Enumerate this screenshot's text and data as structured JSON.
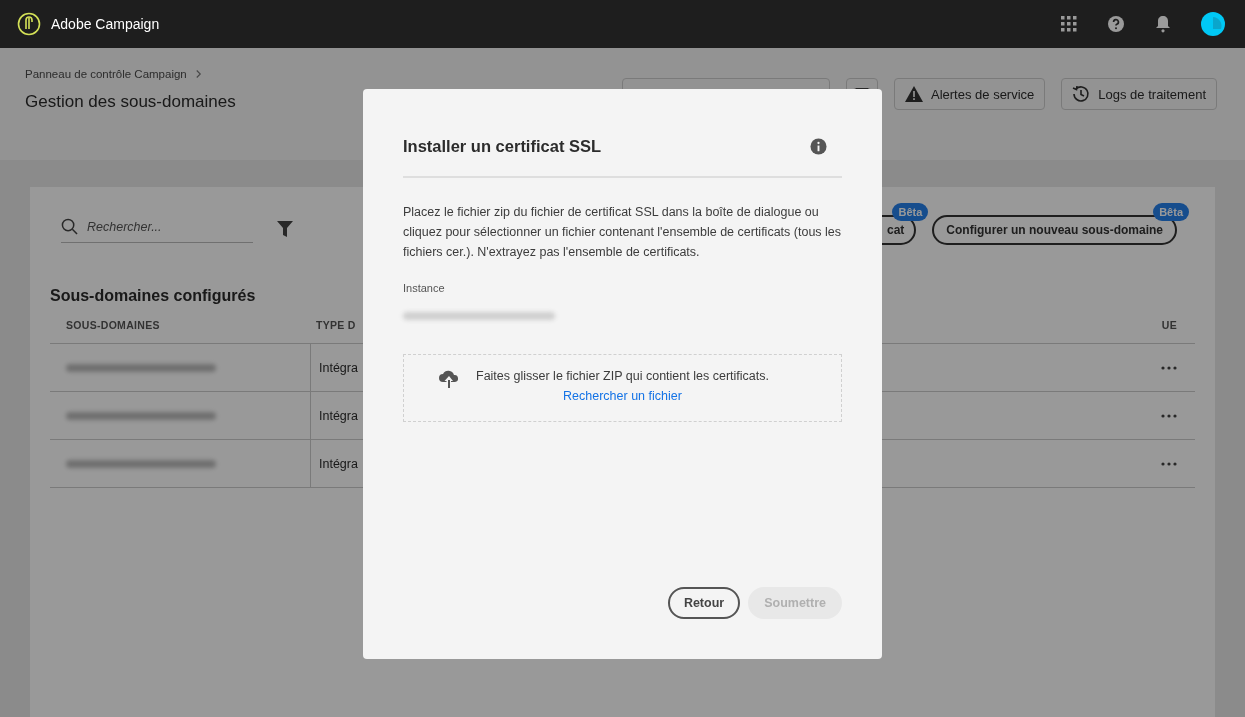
{
  "app": {
    "name": "Adobe Campaign"
  },
  "breadcrumb": "Panneau de contrôle Campaign",
  "page_title": "Gestion des sous-domaines",
  "header_buttons": [
    {
      "label": "Alertes de service",
      "kind": "alert"
    },
    {
      "label": "Logs de traitement",
      "kind": "history"
    }
  ],
  "search": {
    "placeholder": "Rechercher..."
  },
  "action_buttons": [
    {
      "label": "cat",
      "badge": "Bêta"
    },
    {
      "label": "Configurer un nouveau sous-domaine",
      "badge": "Bêta"
    }
  ],
  "section_title": "Sous-domaines configurés",
  "table": {
    "columns": [
      "SOUS-DOMAINES",
      "TYPE D",
      "UE"
    ],
    "rows": [
      {
        "type": "Intégra"
      },
      {
        "type": "Intégra"
      },
      {
        "type": "Intégra"
      }
    ]
  },
  "dialog": {
    "title": "Installer un certificat SSL",
    "description": "Placez le fichier zip du fichier de certificat SSL dans la boîte de dialogue ou cliquez pour sélectionner un fichier contenant l'ensemble de certificats (tous les fichiers cer.). N'extrayez pas l'ensemble de certificats.",
    "instance_label": "Instance",
    "dropzone_text": "Faites glisser le fichier ZIP qui contient les certificats.",
    "dropzone_link": "Rechercher un fichier",
    "buttons": [
      {
        "label": "Retour",
        "disabled": false
      },
      {
        "label": "Soumettre",
        "disabled": true
      }
    ]
  }
}
